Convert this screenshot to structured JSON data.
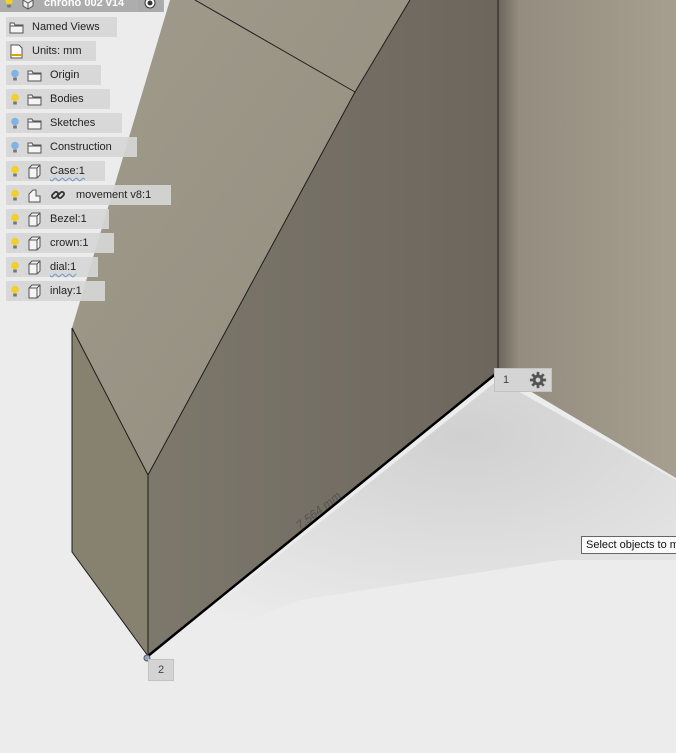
{
  "browser": {
    "document_title": "chrono 002 v14",
    "named_views": "Named Views",
    "units": "Units: mm",
    "items": [
      {
        "label": "Origin",
        "bulb": "blue",
        "icon": "folder-icon"
      },
      {
        "label": "Bodies",
        "bulb": "yellow",
        "icon": "folder-icon"
      },
      {
        "label": "Sketches",
        "bulb": "blue",
        "icon": "folder-icon"
      },
      {
        "label": "Construction",
        "bulb": "blue",
        "icon": "folder-icon"
      },
      {
        "label": "Case:1",
        "bulb": "yellow",
        "icon": "component-icon"
      },
      {
        "label": "movement v8:1",
        "bulb": "yellow",
        "icon": "linked-component-icon"
      },
      {
        "label": "Bezel:1",
        "bulb": "yellow",
        "icon": "component-icon"
      },
      {
        "label": "crown:1",
        "bulb": "yellow",
        "icon": "component-icon"
      },
      {
        "label": "dial:1",
        "bulb": "yellow",
        "icon": "component-icon"
      },
      {
        "label": "inlay:1",
        "bulb": "yellow",
        "icon": "component-icon"
      }
    ]
  },
  "viewport": {
    "dimension_label": "7.564 mm",
    "vertex_1": "1",
    "vertex_2": "2",
    "tooltip": "Select objects to m"
  },
  "colors": {
    "bulb_yellow": "#f2d02a",
    "bulb_blue": "#7fb2e5",
    "background": "#ececec"
  }
}
